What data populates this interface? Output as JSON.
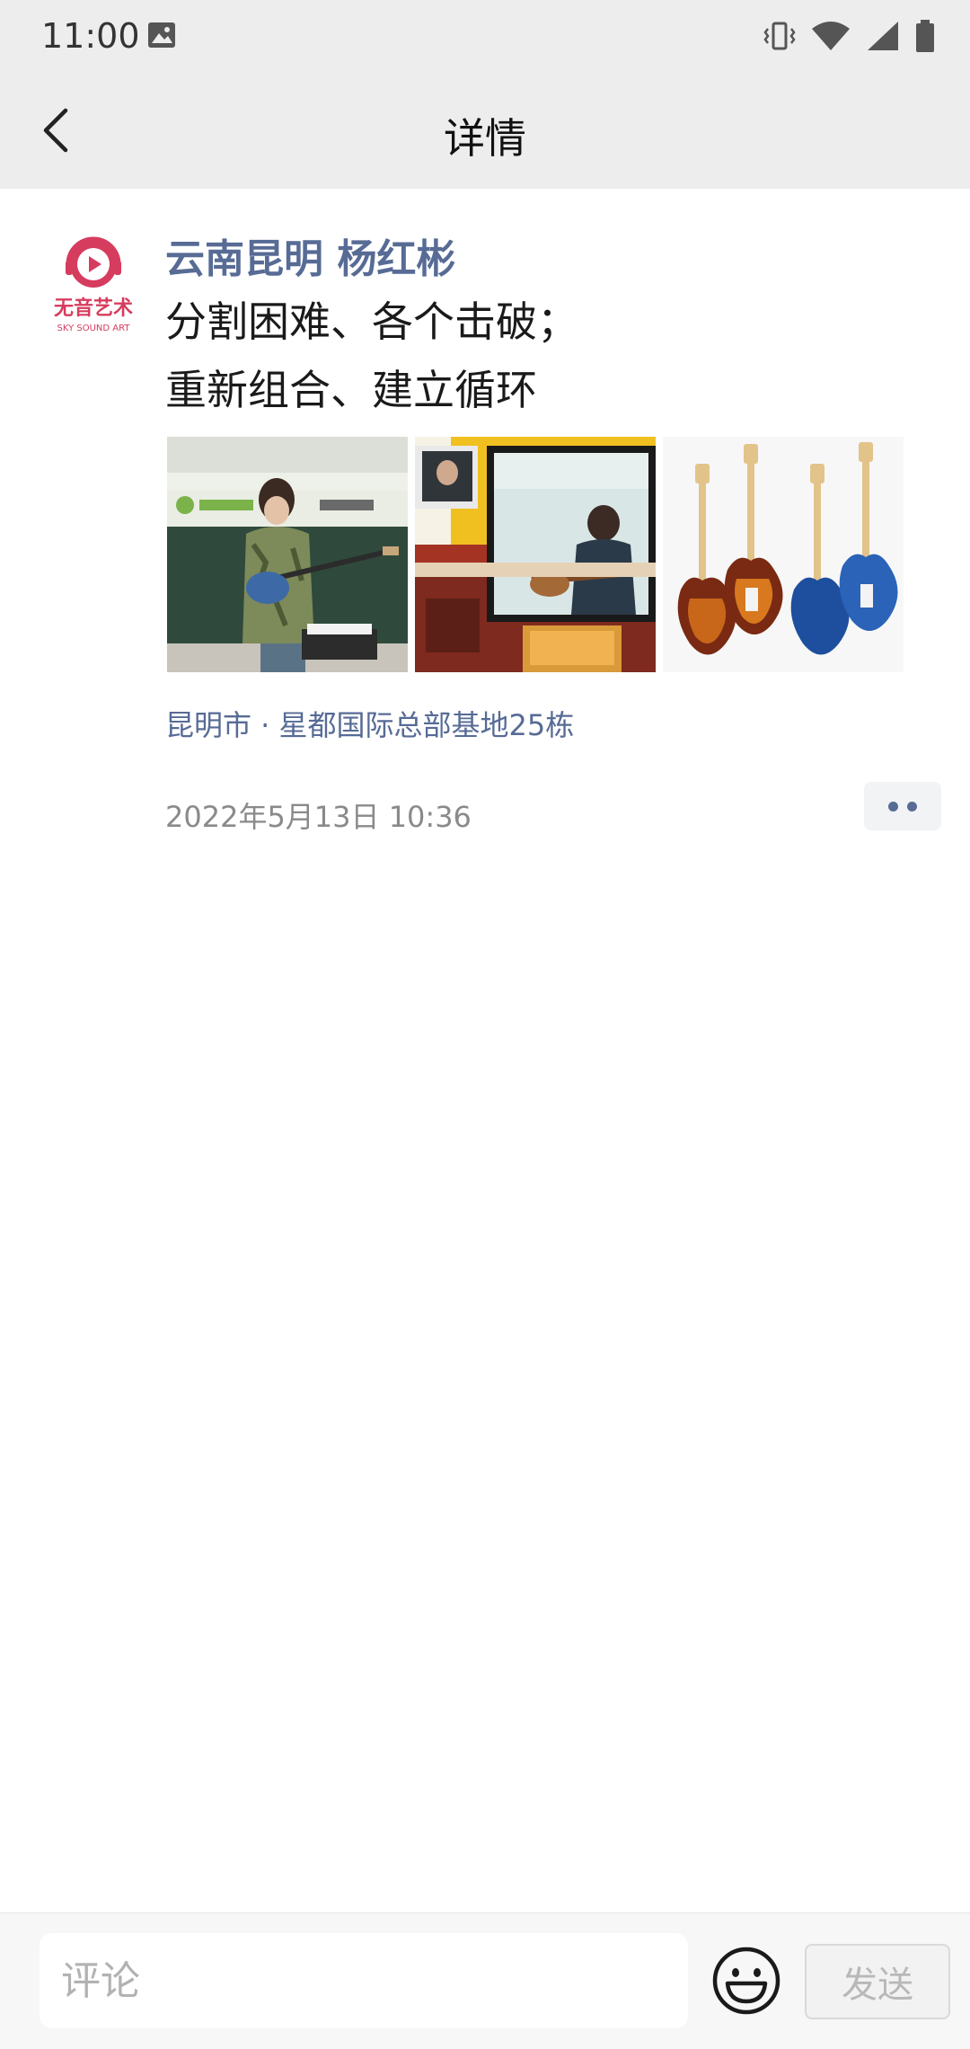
{
  "status_bar": {
    "time": "11:00",
    "icons": [
      "image-icon",
      "vibrate-icon",
      "wifi-icon",
      "cell-signal-icon",
      "battery-icon"
    ]
  },
  "nav": {
    "title": "详情",
    "back_icon": "chevron-left-icon"
  },
  "post": {
    "author": "云南昆明 杨红彬",
    "lines": [
      "分割困难、各个击破；",
      "重新组合、建立循环"
    ],
    "avatar": {
      "logo_text": "无音艺术",
      "logo_subtext": "SKY SOUND ART",
      "brand_color": "#d63c5e"
    },
    "photos": [
      {
        "name": "teacher-playing-guitar-photo"
      },
      {
        "name": "online-class-screen-photo"
      },
      {
        "name": "electric-guitars-photo"
      }
    ],
    "location": "昆明市 · 星都国际总部基地25栋",
    "timestamp": "2022年5月13日 10:36"
  },
  "comment_bar": {
    "placeholder": "评论",
    "send_label": "发送"
  },
  "colors": {
    "link": "#576b95",
    "header_bg": "#ededed",
    "meta_text": "#8a8a8a"
  }
}
